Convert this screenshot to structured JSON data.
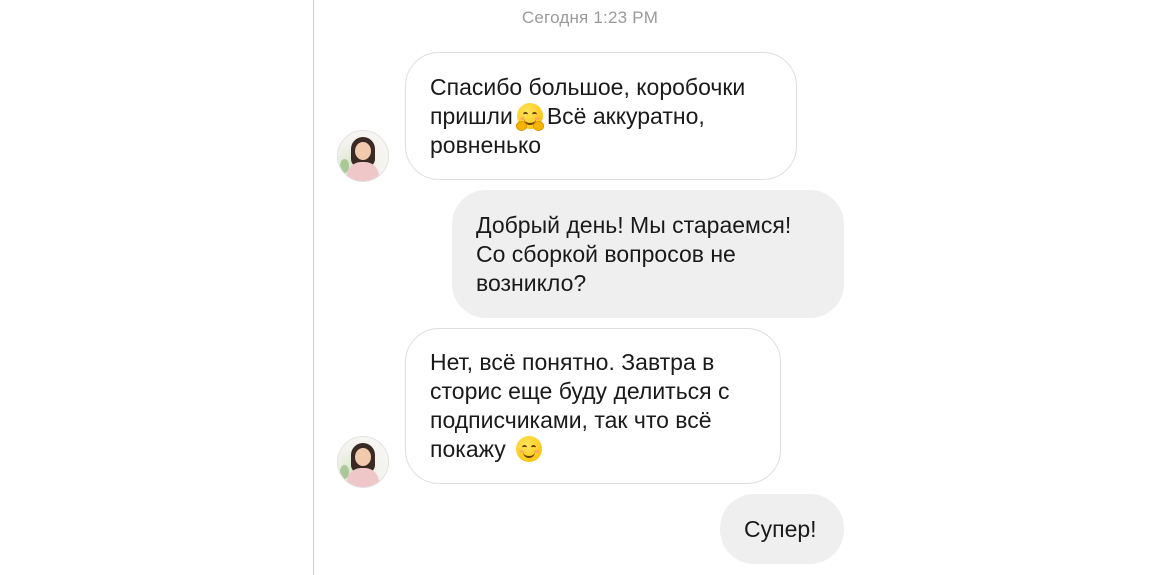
{
  "chat": {
    "timestamp": "Сегодня 1:23 PM",
    "messages": [
      {
        "sender": "contact",
        "lines": [
          "Спасибо большое, коробочки",
          "пришли",
          "Всё аккуратно,",
          "ровненько"
        ],
        "emoji": "hugging-face"
      },
      {
        "sender": "me",
        "text": "Добрый день! Мы стараемся!\nСо сборкой вопросов не\nвозникло?"
      },
      {
        "sender": "contact",
        "lines": [
          "Нет, всё понятно. Завтра в",
          "сторис еще буду делиться с",
          "подписчиками, так что всё",
          "покажу"
        ],
        "emoji": "smiling-face"
      },
      {
        "sender": "me",
        "text": "Супер!"
      }
    ]
  },
  "colors": {
    "incoming_bubble": "#ffffff",
    "incoming_border": "#dedede",
    "outgoing_bubble": "#efefef",
    "timestamp": "#9a9a9a",
    "emoji": "#ffcf26"
  },
  "icons": [
    "avatar-photo",
    "hugging-face-emoji",
    "smiling-face-emoji"
  ]
}
